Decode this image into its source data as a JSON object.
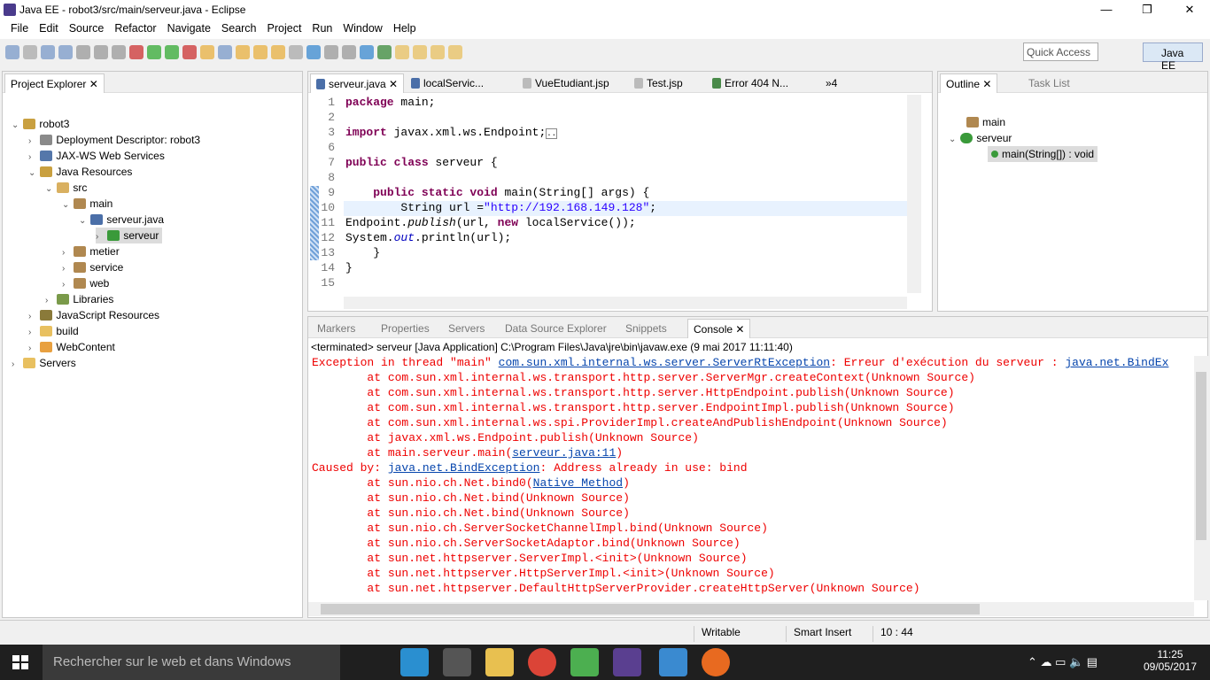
{
  "window": {
    "title": "Java EE - robot3/src/main/serveur.java - Eclipse",
    "minimize": "—",
    "maximize": "❐",
    "close": "✕"
  },
  "menu": [
    "File",
    "Edit",
    "Source",
    "Refactor",
    "Navigate",
    "Search",
    "Project",
    "Run",
    "Window",
    "Help"
  ],
  "toolbar": {
    "quick_access": "Quick Access",
    "perspective": "Java EE"
  },
  "project_explorer": {
    "title": "Project Explorer",
    "items": [
      {
        "label": "robot3",
        "depth": 0,
        "twisty": "⌄",
        "color": "#c9a040"
      },
      {
        "label": "Deployment Descriptor: robot3",
        "depth": 1,
        "twisty": "›",
        "color": "#8a8a8a"
      },
      {
        "label": "JAX-WS Web Services",
        "depth": 1,
        "twisty": "›",
        "color": "#5577aa"
      },
      {
        "label": "Java Resources",
        "depth": 1,
        "twisty": "⌄",
        "color": "#c9a040"
      },
      {
        "label": "src",
        "depth": 2,
        "twisty": "⌄",
        "color": "#d9b060"
      },
      {
        "label": "main",
        "depth": 3,
        "twisty": "⌄",
        "color": "#b08850"
      },
      {
        "label": "serveur.java",
        "depth": 4,
        "twisty": "⌄",
        "color": "#4b6fa8"
      },
      {
        "label": "serveur",
        "depth": 5,
        "twisty": "›",
        "color": "#3a9a3a"
      },
      {
        "label": "metier",
        "depth": 3,
        "twisty": "›",
        "color": "#b08850"
      },
      {
        "label": "service",
        "depth": 3,
        "twisty": "›",
        "color": "#b08850"
      },
      {
        "label": "web",
        "depth": 3,
        "twisty": "›",
        "color": "#b08850"
      },
      {
        "label": "Libraries",
        "depth": 2,
        "twisty": "›",
        "color": "#7a9a4a"
      },
      {
        "label": "JavaScript Resources",
        "depth": 1,
        "twisty": "›",
        "color": "#8a7a3a"
      },
      {
        "label": "build",
        "depth": 1,
        "twisty": "›",
        "color": "#e8c060"
      },
      {
        "label": "WebContent",
        "depth": 1,
        "twisty": "›",
        "color": "#e8a040"
      },
      {
        "label": "Servers",
        "depth": 0,
        "twisty": "›",
        "color": "#e8c060"
      }
    ]
  },
  "editor": {
    "tabs": [
      "serveur.java",
      "localServic...",
      "VueEtudiant.jsp",
      "Test.jsp",
      "Error 404 N..."
    ],
    "overflow": "»4",
    "line_numbers": [
      "1",
      "2",
      "3",
      "6",
      "7",
      "8",
      "9",
      "10",
      "11",
      "12",
      "13",
      "14",
      "15"
    ]
  },
  "outline": {
    "title": "Outline",
    "task_list": "Task List",
    "items": [
      "main",
      "serveur",
      "main(String[]) : void"
    ]
  },
  "console_tabs": [
    "Markers",
    "Properties",
    "Servers",
    "Data Source Explorer",
    "Snippets",
    "Console"
  ],
  "console": {
    "header": "<terminated> serveur [Java Application] C:\\Program Files\\Java\\jre\\bin\\javaw.exe (9 mai 2017 11:11:40)",
    "line0": {
      "a": "Exception in thread \"main\" ",
      "link": "com.sun.xml.internal.ws.server.ServerRtException",
      "b": ": Erreur d'exécution du serveur : ",
      "link2": "java.net.BindEx"
    },
    "stack1": [
      "\tat com.sun.xml.internal.ws.transport.http.server.ServerMgr.createContext(Unknown Source)",
      "\tat com.sun.xml.internal.ws.transport.http.server.HttpEndpoint.publish(Unknown Source)",
      "\tat com.sun.xml.internal.ws.transport.http.server.EndpointImpl.publish(Unknown Source)",
      "\tat com.sun.xml.internal.ws.spi.ProviderImpl.createAndPublishEndpoint(Unknown Source)",
      "\tat javax.xml.ws.Endpoint.publish(Unknown Source)"
    ],
    "mainline": {
      "a": "\tat main.serveur.main(",
      "link": "serveur.java:11",
      "b": ")"
    },
    "caused": {
      "a": "Caused by: ",
      "link": "java.net.BindException",
      "b": ": Address already in use: bind"
    },
    "native": {
      "a": "\tat sun.nio.ch.Net.bind0(",
      "link": "Native Method",
      "b": ")"
    },
    "stack2": [
      "\tat sun.nio.ch.Net.bind(Unknown Source)",
      "\tat sun.nio.ch.Net.bind(Unknown Source)",
      "\tat sun.nio.ch.ServerSocketChannelImpl.bind(Unknown Source)",
      "\tat sun.nio.ch.ServerSocketAdaptor.bind(Unknown Source)",
      "\tat sun.net.httpserver.ServerImpl.<init>(Unknown Source)",
      "\tat sun.net.httpserver.HttpServerImpl.<init>(Unknown Source)",
      "\tat sun.net.httpserver.DefaultHttpServerProvider.createHttpServer(Unknown Source)"
    ]
  },
  "status": {
    "writable": "Writable",
    "insert": "Smart Insert",
    "position": "10 : 44"
  },
  "taskbar": {
    "search": "Rechercher sur le web et dans Windows",
    "time": "11:25",
    "date": "09/05/2017"
  }
}
